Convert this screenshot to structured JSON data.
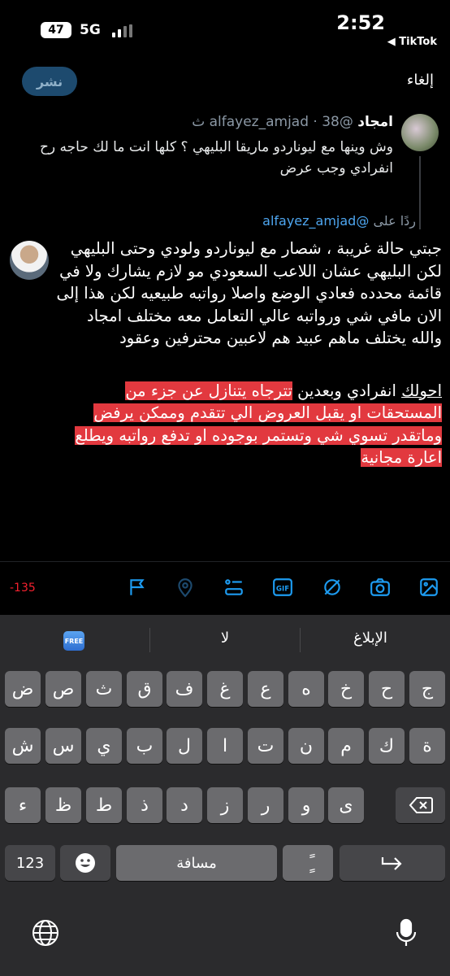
{
  "status": {
    "battery": "47",
    "network": "5G",
    "time": "2:52",
    "back_app": "◀ TikTok"
  },
  "header": {
    "post_label": "نشر",
    "cancel_label": "إلغاء"
  },
  "original_tweet": {
    "author": "امجاد",
    "handle": "@alfayez_amjad",
    "time": "38 ث",
    "text": "وش وينها مع ليوناردو ماريقا البليهي ؟ كلها انت ما لك حاجه رح انفرادي وجب عرض"
  },
  "reply_to": {
    "prefix": "ردًا على",
    "handle": "@alfayez_amjad"
  },
  "compose": {
    "paragraph1": "جبتي حالة غريبة ، شصار مع ليوناردو ولودي وحتى البليهي لكن البليهي عشان اللاعب السعودي مو لازم يشارك ولا في قائمة محدده فعادي الوضع واصلا رواتبه طبيعيه لكن هذا إلى الان مافي شي ورواتبه عالي التعامل معه مختلف امجاد والله يختلف ماهم عبيد هم لاعبين محترفين وعقود",
    "p2_underlined": "احولك",
    "p2_plain": " انفرادي وبعدين ",
    "p2_highlighted": "تترجاه يتنازل عن جزء من المستحقات او يقبل العروض الي تتقدم وممكن يرفض وماتقدر تسوي شي وتستمر بوجوده او تدفع رواتبه ويطلع اعارة مجانية"
  },
  "toolbar": {
    "char_count": "-135",
    "gif_label": "GIF",
    "accent_color": "#1d9bf0"
  },
  "keyboard": {
    "suggestions": [
      "الإبلاغ",
      "لا",
      "FREE"
    ],
    "row1": [
      "ج",
      "ح",
      "خ",
      "ه",
      "ع",
      "غ",
      "ف",
      "ق",
      "ث",
      "ص",
      "ض"
    ],
    "row2": [
      "ة",
      "ك",
      "م",
      "ن",
      "ت",
      "ا",
      "ل",
      "ب",
      "ي",
      "س",
      "ش"
    ],
    "row3": [
      "ى",
      "و",
      "ر",
      "ز",
      "د",
      "ذ",
      "ط",
      "ظ",
      "ء"
    ],
    "numbers_label": "123",
    "space_label": "مسافة",
    "tanween_label": "ًٍ"
  }
}
